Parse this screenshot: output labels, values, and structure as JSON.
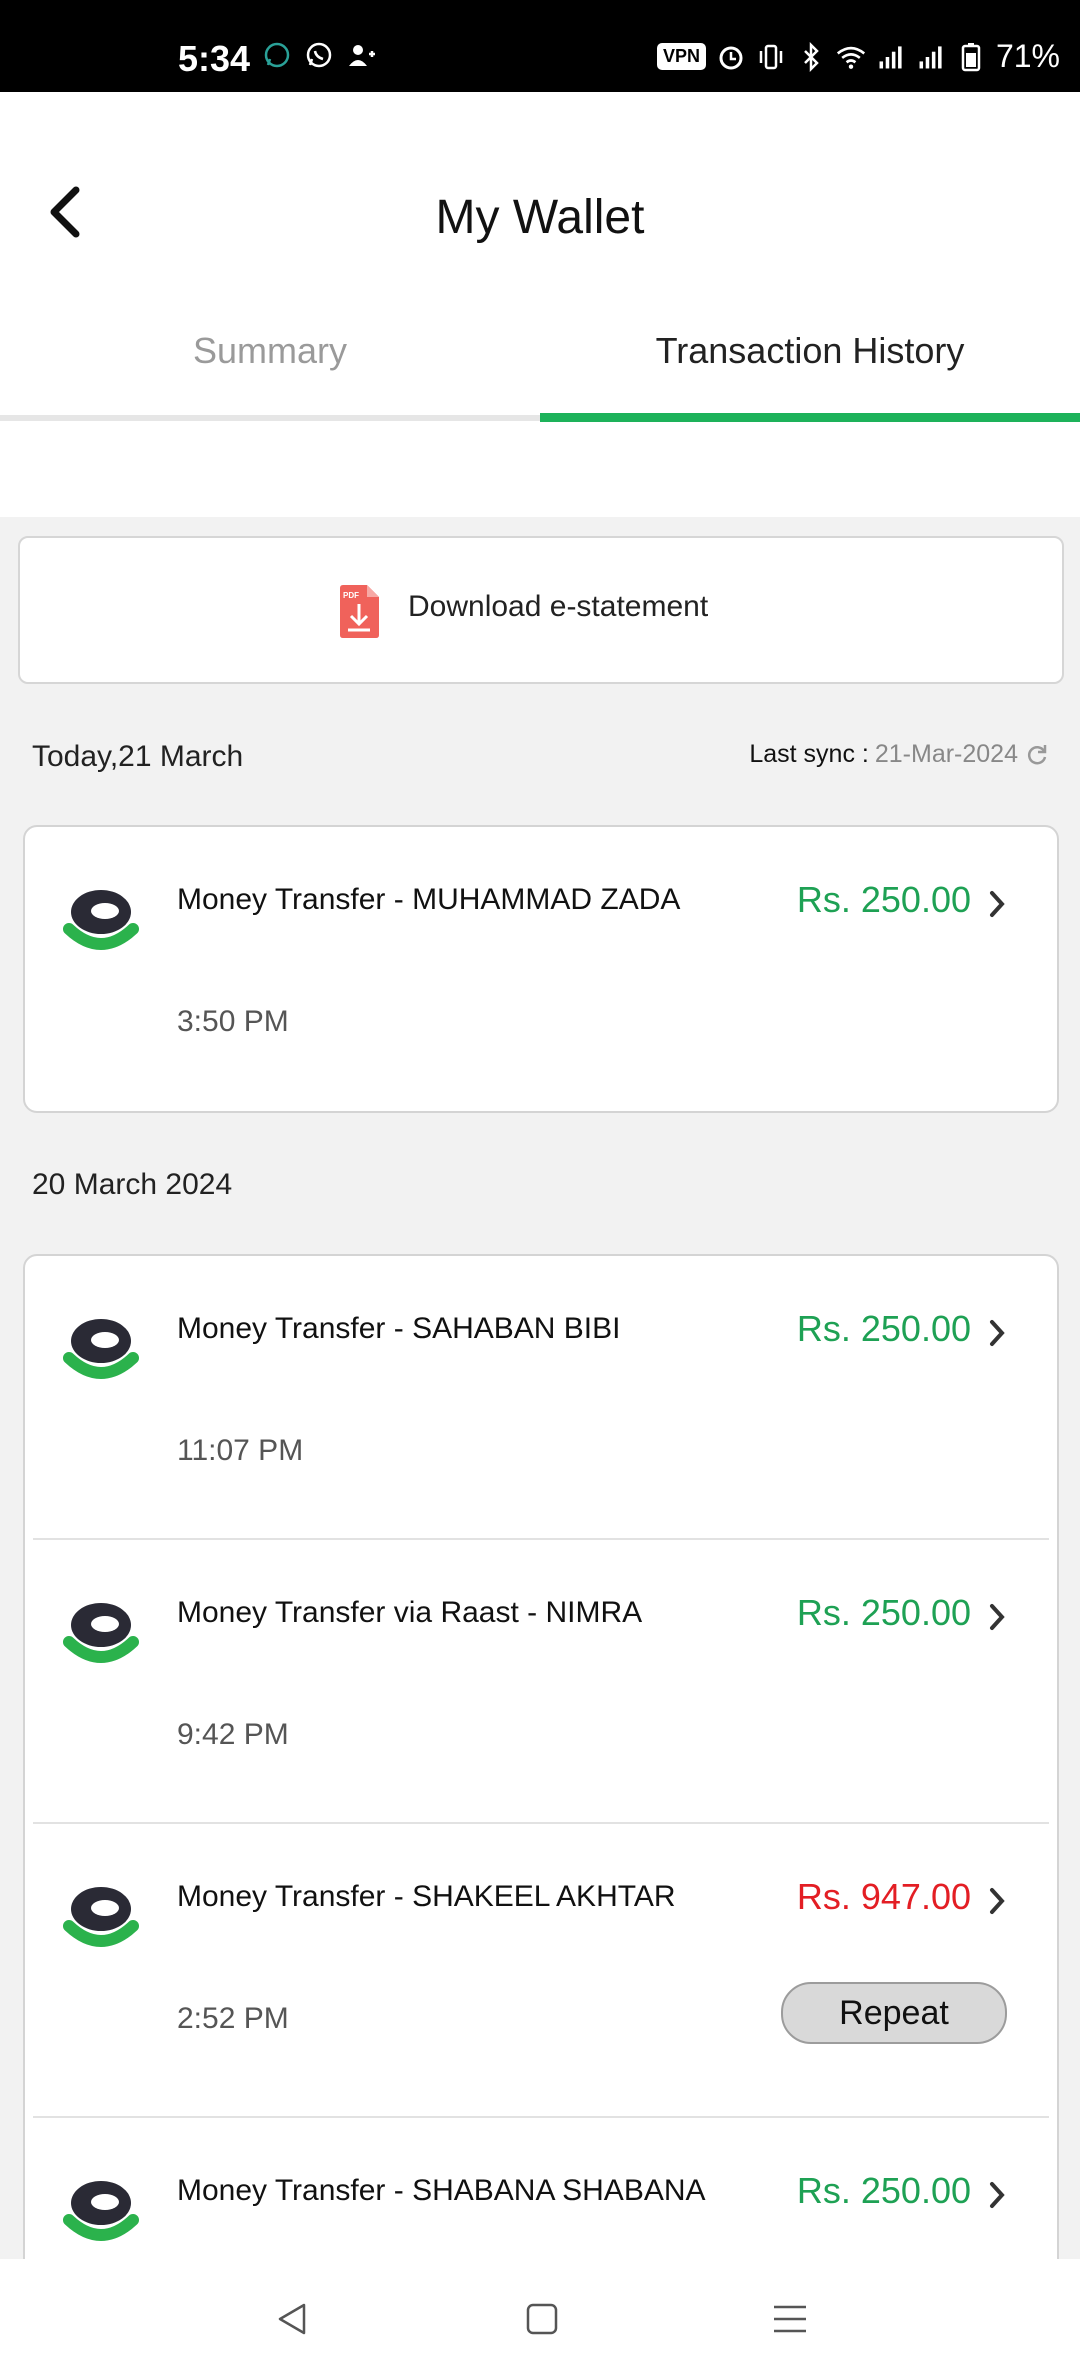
{
  "status_bar": {
    "time": "5:34",
    "vpn": "VPN",
    "battery": "71%",
    "left_icons": [
      "whatsapp-business-icon",
      "whatsapp-icon",
      "add-contact-icon"
    ],
    "right_icons": [
      "vpn-icon",
      "alarm-icon",
      "vibrate-icon",
      "bluetooth-icon",
      "wifi-icon",
      "signal-icon",
      "signal-icon",
      "battery-icon"
    ]
  },
  "header": {
    "title": "My Wallet",
    "back_icon": "chevron-left-icon"
  },
  "tabs": [
    {
      "label": "Summary",
      "active": false
    },
    {
      "label": "Transaction History",
      "active": true
    }
  ],
  "colors": {
    "accent_green": "#1db25a",
    "amount_green": "#1ea154",
    "amount_red": "#e31e24"
  },
  "estatement": {
    "label": "Download e-statement",
    "icon": "pdf-download-icon"
  },
  "sync": {
    "label": "Last sync :",
    "value": "21-Mar-2024",
    "icon": "refresh-icon"
  },
  "groups": [
    {
      "date": "Today,21 March",
      "transactions": [
        {
          "title": "Money Transfer - MUHAMMAD ZADA",
          "amount": "Rs. 250.00",
          "time": "3:50 PM",
          "type": "credit"
        }
      ]
    },
    {
      "date": "20 March 2024",
      "transactions": [
        {
          "title": "Money Transfer - SAHABAN BIBI",
          "amount": "Rs. 250.00",
          "time": "11:07 PM",
          "type": "credit"
        },
        {
          "title": "Money Transfer via Raast - NIMRA",
          "amount": "Rs. 250.00",
          "time": "9:42 PM",
          "type": "credit"
        },
        {
          "title": "Money Transfer - SHAKEEL AKHTAR",
          "amount": "Rs. 947.00",
          "time": "2:52 PM",
          "type": "debit",
          "action": "Repeat"
        },
        {
          "title": "Money Transfer - SHABANA SHABANA",
          "amount": "Rs. 250.00",
          "time": "",
          "type": "credit"
        }
      ]
    }
  ],
  "nav_bar": [
    "back-nav-icon",
    "home-nav-icon",
    "recents-nav-icon"
  ]
}
